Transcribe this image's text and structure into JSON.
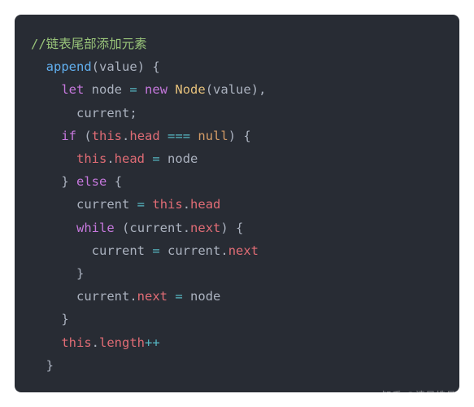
{
  "code": {
    "comment": "//链表尾部添加元素",
    "func_name": "append",
    "param": "value",
    "kw_let": "let",
    "var_node": "node",
    "op_assign": "=",
    "kw_new": "new",
    "class_node": "Node",
    "var_current": "current",
    "kw_if": "if",
    "kw_this": "this",
    "prop_head": "head",
    "op_eq3": "===",
    "lit_null": "null",
    "kw_else": "else",
    "kw_while": "while",
    "prop_next": "next",
    "prop_length": "length",
    "op_inc": "++",
    "brace_open": "{",
    "brace_close": "}",
    "paren_open": "(",
    "paren_close": ")",
    "comma": ",",
    "semicolon": ";",
    "dot": "."
  },
  "watermark": "知乎 @清风皓月"
}
